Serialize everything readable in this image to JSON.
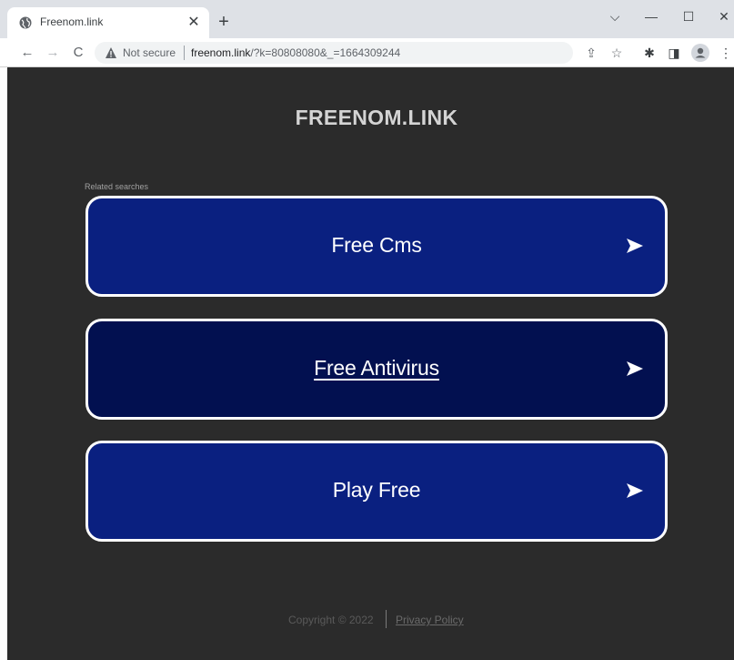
{
  "browser": {
    "tab": {
      "title": "Freenom.link",
      "close_glyph": "✕",
      "favicon": "globe-icon"
    },
    "new_tab_glyph": "+",
    "window_controls": {
      "tabsearch_glyph": "⌵",
      "minimize_glyph": "—",
      "maximize_glyph": "☐",
      "close_glyph": "✕"
    },
    "nav": {
      "back_glyph": "←",
      "forward_glyph": "→",
      "reload_glyph": "C"
    },
    "omnibox": {
      "security_label": "Not secure",
      "url_host": "freenom.link",
      "url_path": "/?k=80808080&_=1664309244"
    },
    "toolbar_icons": {
      "share_glyph": "⇪",
      "star_glyph": "☆",
      "extensions_glyph": "✱",
      "sidepanel_glyph": "◨",
      "menu_glyph": "⋮"
    }
  },
  "page": {
    "site_title": "FREENOM.LINK",
    "related_label": "Related searches",
    "search_buttons": [
      {
        "label": "Free Cms"
      },
      {
        "label": "Free Antivirus"
      },
      {
        "label": "Play Free"
      }
    ],
    "footer": {
      "copyright": "Copyright © 2022",
      "privacy_link": "Privacy Policy"
    }
  },
  "colors": {
    "page_background": "#2b2b2b",
    "button_blue": "#0a2080",
    "button_dark_blue": "#021050",
    "button_border": "#ffffff"
  }
}
